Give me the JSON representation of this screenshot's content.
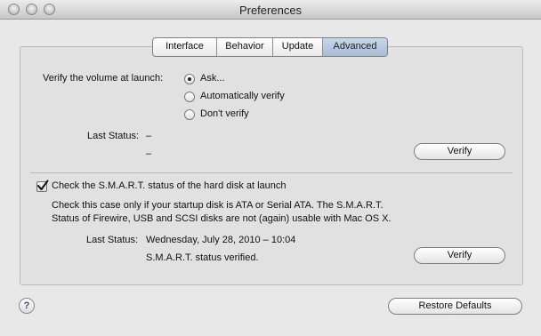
{
  "window": {
    "title": "Preferences"
  },
  "tabs": [
    {
      "label": "Interface"
    },
    {
      "label": "Behavior"
    },
    {
      "label": "Update"
    },
    {
      "label": "Advanced"
    }
  ],
  "verify_section": {
    "label": "Verify the volume at launch:",
    "options": [
      {
        "label": "Ask...",
        "selected": true
      },
      {
        "label": "Automatically verify",
        "selected": false
      },
      {
        "label": "Don't verify",
        "selected": false
      }
    ],
    "last_status_label": "Last Status:",
    "last_status_line1": "–",
    "last_status_line2": "–",
    "verify_button": "Verify"
  },
  "smart_section": {
    "checkbox_label": "Check the S.M.A.R.T. status of the hard disk at launch",
    "checked": true,
    "description_line1": "Check this case only if your startup disk is ATA or Serial ATA. The S.M.A.R.T.",
    "description_line2": "Status of Firewire, USB and SCSI disks are not (again) usable with Mac OS X.",
    "last_status_label": "Last Status:",
    "last_status_date": "Wednesday, July 28, 2010 – 10:04",
    "last_status_result": "S.M.A.R.T. status verified.",
    "verify_button": "Verify"
  },
  "footer": {
    "help_glyph": "?",
    "restore_button": "Restore Defaults"
  },
  "icons": {
    "close": "close-button-icon",
    "minimize": "minimize-button-icon",
    "zoom": "zoom-button-icon",
    "help": "help-icon"
  }
}
